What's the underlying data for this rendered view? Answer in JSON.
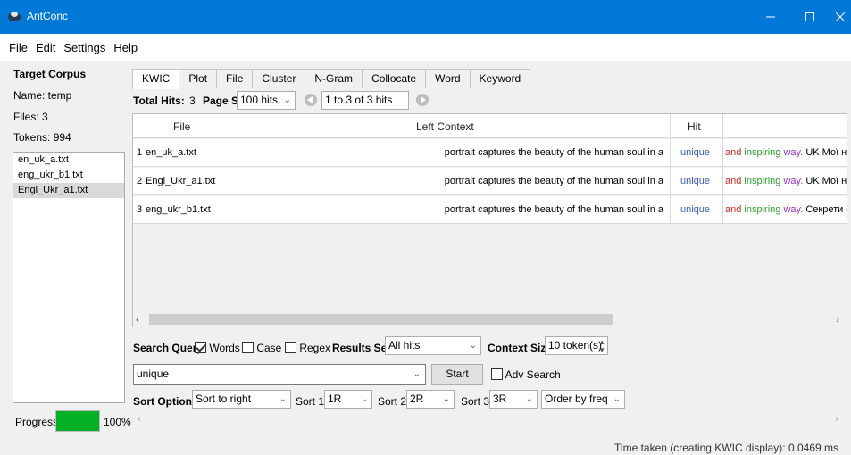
{
  "window": {
    "title": "AntConc"
  },
  "menu": [
    "File",
    "Edit",
    "Settings",
    "Help"
  ],
  "corpus": {
    "heading": "Target Corpus",
    "name": "Name:  temp",
    "files": "Files:   3",
    "tokens": "Tokens: 994",
    "file_list": [
      "en_uk_a.txt",
      "eng_ukr_b1.txt",
      "Engl_Ukr_a1.txt"
    ],
    "selected_index": 2
  },
  "progress": {
    "label": "Progress",
    "value_pct": 100,
    "text": "100%",
    "color": "#06b025"
  },
  "tabs": [
    "KWIC",
    "Plot",
    "File",
    "Cluster",
    "N-Gram",
    "Collocate",
    "Word",
    "Keyword"
  ],
  "active_tab": 0,
  "hits": {
    "total_label": "Total Hits:",
    "total_value": "3",
    "page_size_label": "Page Size",
    "page_size": "100 hits",
    "range": "1 to 3 of 3 hits"
  },
  "table": {
    "headers": {
      "file": "File",
      "left": "Left Context",
      "hit": "Hit"
    },
    "rows": [
      {
        "num": "1",
        "file": "en_uk_a.txt",
        "left": "portrait captures the beauty of the human soul in a",
        "hit": "unique",
        "r1": "and",
        "r2": "inspiring",
        "r3": "way.",
        "rest": "UK Мої на"
      },
      {
        "num": "2",
        "file": "Engl_Ukr_a1.txt",
        "left": "portrait captures the beauty of the human soul in a",
        "hit": "unique",
        "r1": "and",
        "r2": "inspiring",
        "r3": "way.",
        "rest": "UK Мої на"
      },
      {
        "num": "3",
        "file": "eng_ukr_b1.txt",
        "left": "portrait captures the beauty of the human soul in a",
        "hit": "unique",
        "r1": "and",
        "r2": "inspiring",
        "r3": "way.",
        "rest": "Секрети с"
      }
    ]
  },
  "colors": {
    "hit": "#3a5bc7",
    "r1": "#d62728",
    "r2": "#2ca02c",
    "r3": "#9b30c7",
    "accent": "#0078d7"
  },
  "search": {
    "query_label": "Search Query",
    "words_label": "Words",
    "words_checked": true,
    "case_label": "Case",
    "case_checked": false,
    "regex_label": "Regex",
    "regex_checked": false,
    "results_set_label": "Results Set",
    "results_set": "All hits",
    "context_size_label": "Context Size",
    "context_size": "10 token(s)",
    "query": "unique",
    "start_label": "Start",
    "adv_label": "Adv Search",
    "adv_checked": false
  },
  "sort": {
    "label": "Sort Options",
    "mode": "Sort to right",
    "sort1_label": "Sort 1",
    "sort1": "1R",
    "sort2_label": "Sort 2",
    "sort2": "2R",
    "sort3_label": "Sort 3",
    "sort3": "3R",
    "order": "Order by freq"
  },
  "status": {
    "text": "Time taken (creating KWIC display): 0.0469 ms"
  }
}
